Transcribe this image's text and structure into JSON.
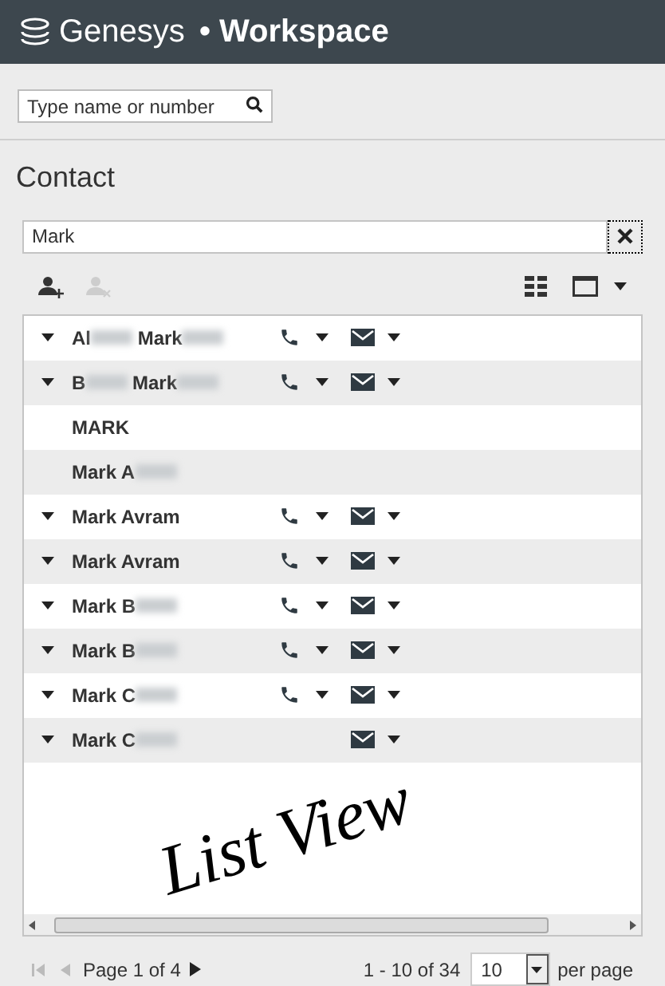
{
  "header": {
    "brand": "Genesys",
    "title": "• Workspace"
  },
  "search": {
    "placeholder": "Type name or number"
  },
  "section_title": "Contact",
  "contact_search": {
    "value": "Mark"
  },
  "toolbar": {
    "add_disabled": false,
    "remove_disabled": true
  },
  "rows": [
    {
      "parts": [
        {
          "text": "Al",
          "blur": true
        },
        {
          "text": " Mark",
          "blur": true
        }
      ],
      "expandable": true,
      "phone": true,
      "email": true
    },
    {
      "parts": [
        {
          "text": "B",
          "blur": true
        },
        {
          "text": " Mark",
          "blur": true
        }
      ],
      "expandable": true,
      "phone": true,
      "email": true
    },
    {
      "parts": [
        {
          "text": "MARK",
          "blur": false
        }
      ],
      "expandable": false,
      "phone": false,
      "email": false
    },
    {
      "parts": [
        {
          "text": "Mark A",
          "blur": true
        }
      ],
      "expandable": false,
      "phone": false,
      "email": false
    },
    {
      "parts": [
        {
          "text": "Mark Avram",
          "blur": false
        }
      ],
      "expandable": true,
      "phone": true,
      "email": true
    },
    {
      "parts": [
        {
          "text": "Mark Avram",
          "blur": false
        }
      ],
      "expandable": true,
      "phone": true,
      "email": true
    },
    {
      "parts": [
        {
          "text": "Mark B",
          "blur": true
        }
      ],
      "expandable": true,
      "phone": true,
      "email": true
    },
    {
      "parts": [
        {
          "text": "Mark B",
          "blur": true
        }
      ],
      "expandable": true,
      "phone": true,
      "email": true
    },
    {
      "parts": [
        {
          "text": "Mark C",
          "blur": true
        }
      ],
      "expandable": true,
      "phone": true,
      "email": true
    },
    {
      "parts": [
        {
          "text": "Mark C",
          "blur": true
        }
      ],
      "expandable": true,
      "phone": false,
      "email": true
    }
  ],
  "annotation": "List View",
  "pagination": {
    "page": "Page 1 of 4",
    "range": "1 - 10 of 34",
    "per_page_value": "10",
    "per_page_label": "per page"
  }
}
